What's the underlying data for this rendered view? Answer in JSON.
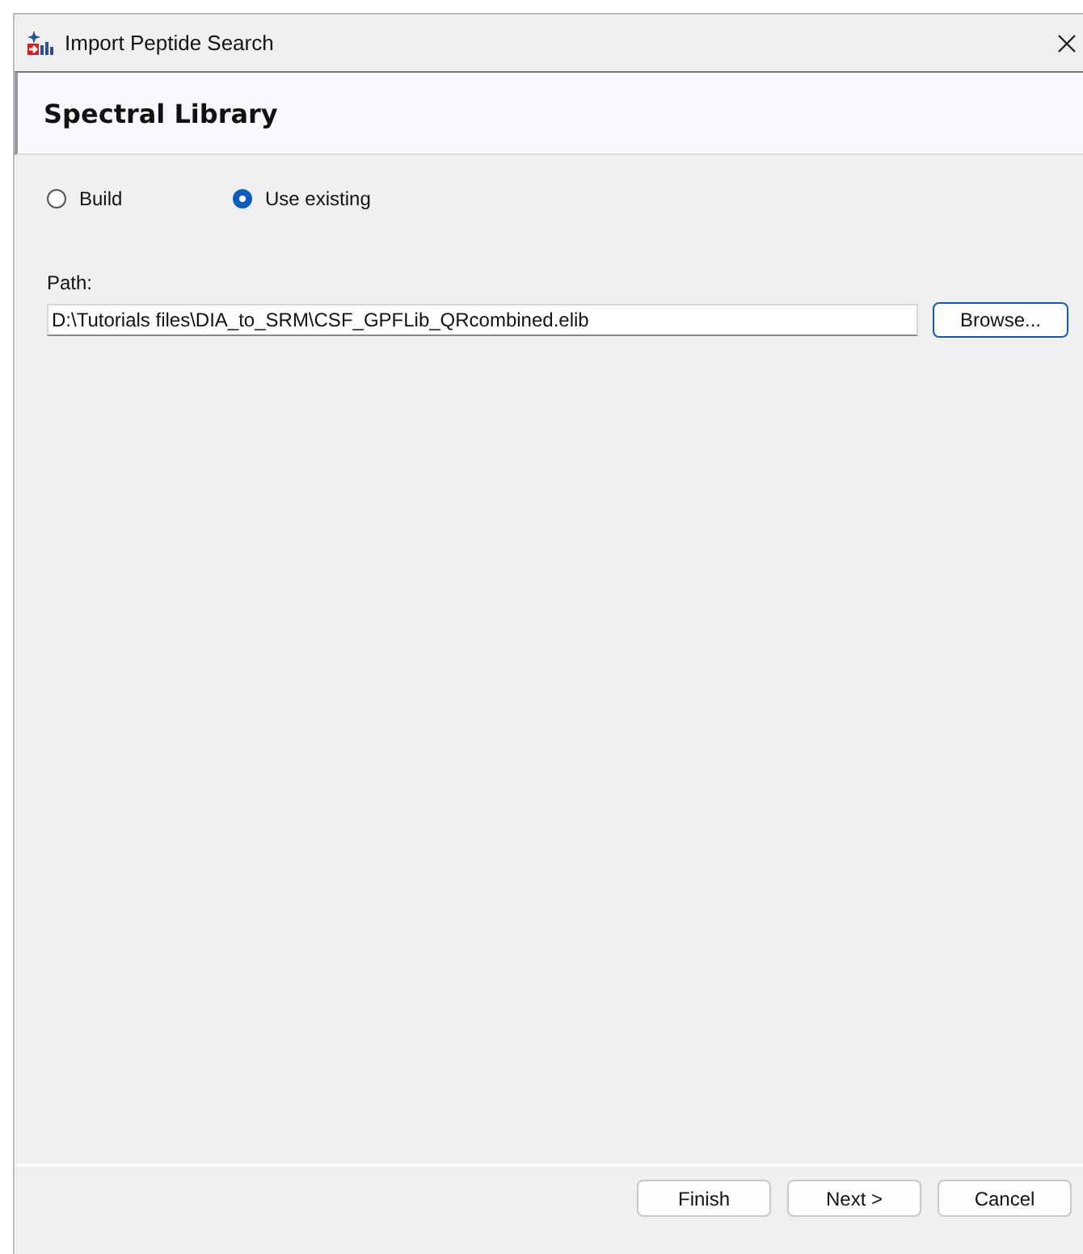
{
  "window": {
    "title": "Import Peptide Search"
  },
  "page": {
    "heading": "Spectral Library"
  },
  "options": [
    {
      "label": "Build",
      "selected": false
    },
    {
      "label": "Use existing",
      "selected": true
    }
  ],
  "path": {
    "label": "Path:",
    "value": "D:\\Tutorials files\\DIA_to_SRM\\CSF_GPFLib_QRcombined.elib",
    "browse": "Browse..."
  },
  "buttons": [
    "Finish",
    "Next >",
    "Cancel"
  ]
}
